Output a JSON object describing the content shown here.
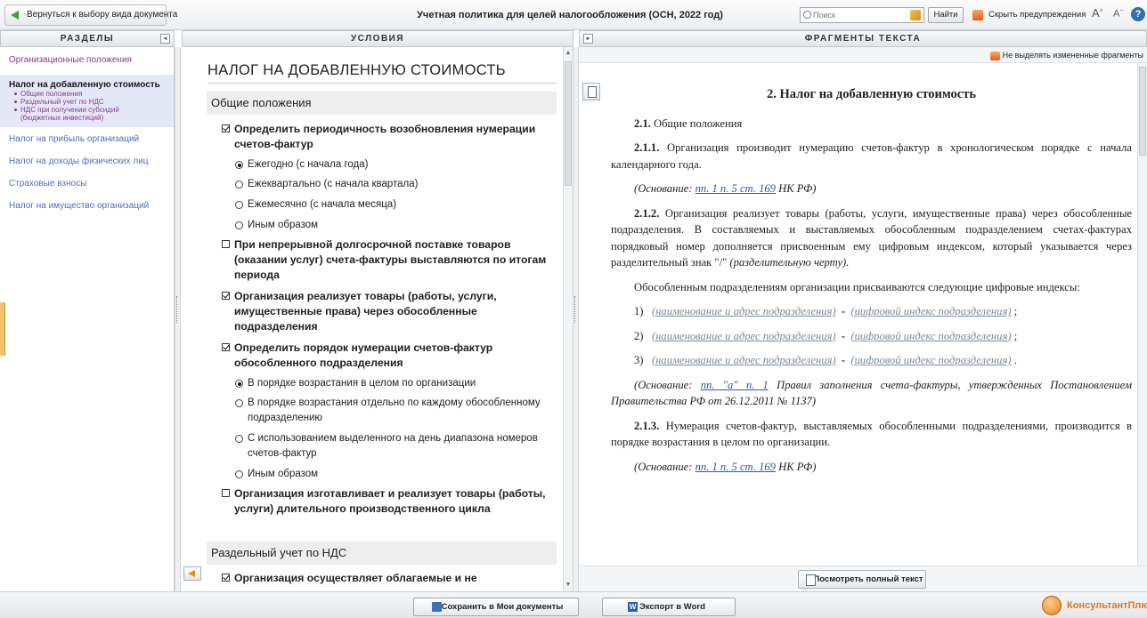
{
  "topbar": {
    "back_label": "Вернуться к выбору вида документа",
    "title": "Учетная политика для целей налогообложения (ОСН, 2022 год)",
    "search_placeholder": "Поиск",
    "find_label": "Найти",
    "hide_warnings_label": "Скрыть предупреждения"
  },
  "columns": {
    "sections_header": "РАЗДЕЛЫ",
    "conditions_header": "УСЛОВИЯ",
    "fragments_header": "ФРАГМЕНТЫ ТЕКСТА"
  },
  "sidebar": {
    "items_before": [
      "Организационные положения"
    ],
    "active": {
      "title": "Налог на добавленную стоимость",
      "subitems": [
        "Общие положения",
        "Раздельный учет по НДС",
        "НДС при получении субсидий",
        "(бюджетных инвестиций)"
      ]
    },
    "items_after": [
      "Налог на прибыль организаций",
      "Налог на доходы физических лиц",
      "Страховые взносы",
      "Налог на имущество организаций"
    ]
  },
  "conditions": {
    "title": "НАЛОГ НА ДОБАВЛЕННУЮ СТОИМОСТЬ",
    "group1": "Общие положения",
    "q1": "Определить периодичность возобновления нумерации счетов-фактур",
    "q1_opts": [
      "Ежегодно (с начала года)",
      "Ежеквартально (с начала квартала)",
      "Ежемесячно (с начала месяца)",
      "Иным образом"
    ],
    "q2": "При непрерывной долгосрочной поставке товаров (оказании услуг) счета-фактуры выставляются по итогам периода",
    "q3": "Организация реализует товары (работы, услуги, имущественные права) через обособленные подразделения",
    "q4": "Определить порядок нумерации счетов-фактур обособленного подразделения",
    "q4_opts": [
      "В порядке возрастания в целом по организации",
      "В порядке возрастания отдельно по каждому обособленному подразделению",
      "С использованием выделенного на день диапазона номеров счетов-фактур",
      "Иным образом"
    ],
    "q5": "Организация изготавливает и реализует товары (работы, услуги) длительного производственного цикла",
    "group2": "Раздельный учет по НДС",
    "q6": "Организация осуществляет облагаемые и не"
  },
  "fragments": {
    "toolbar_label": "Не выделять измененные фрагменты",
    "heading": "2.  Налог на добавленную стоимость",
    "p1_num": "2.1.",
    "p1": " Общие положения",
    "p2_num": "2.1.1.",
    "p2": " Организация производит нумерацию счетов-фактур в хронологическом порядке с начала календарного года.",
    "basis_prefix": "(Основание: ",
    "basis_link": "пп. 1 п. 5 ст. 169",
    "basis_suffix": " НК РФ)",
    "p3_num": "2.1.2.",
    "p3": " Организация реализует товары (работы, услуги, имущественные права) через обособленные подразделения. В составляемых и выставляемых обособленным подразделением счетах-фактурах порядковый номер дополняется присвоенным ему цифровым индексом, который указывается через разделительный знак \"/\" ",
    "p3_it": "(разделительную черту).",
    "p4": "Обособленным подразделениям организации присваиваются следующие цифровые индексы:",
    "list": [
      {
        "num": "1)",
        "name": "(наименование и адрес подразделения)",
        "index": "(цифровой индекс подразделения)",
        "end": ";"
      },
      {
        "num": "2)",
        "name": "(наименование и адрес подразделения)",
        "index": "(цифровой индекс подразделения)",
        "end": ";"
      },
      {
        "num": "3)",
        "name": "(наименование и адрес подразделения)",
        "index": "(цифровой индекс подразделения)",
        "end": "."
      }
    ],
    "basis2_link": "пп. \"а\" п. 1",
    "basis2_suffix": " Правил заполнения счета-фактуры, утвержденных Постановлением Правительства РФ от 26.12.2011 № 1137)",
    "p5_num": "2.1.3.",
    "p5": " Нумерация счетов-фактур, выставляемых обособленными подразделениями, производится в порядке возрастания в целом по организации.",
    "full_text_label": "Посмотреть полный текст"
  },
  "bottombar": {
    "save_label": "Сохранить в Мои документы",
    "word_label": "Экспорт в Word",
    "logo_text": "КонсультантПлюс"
  }
}
